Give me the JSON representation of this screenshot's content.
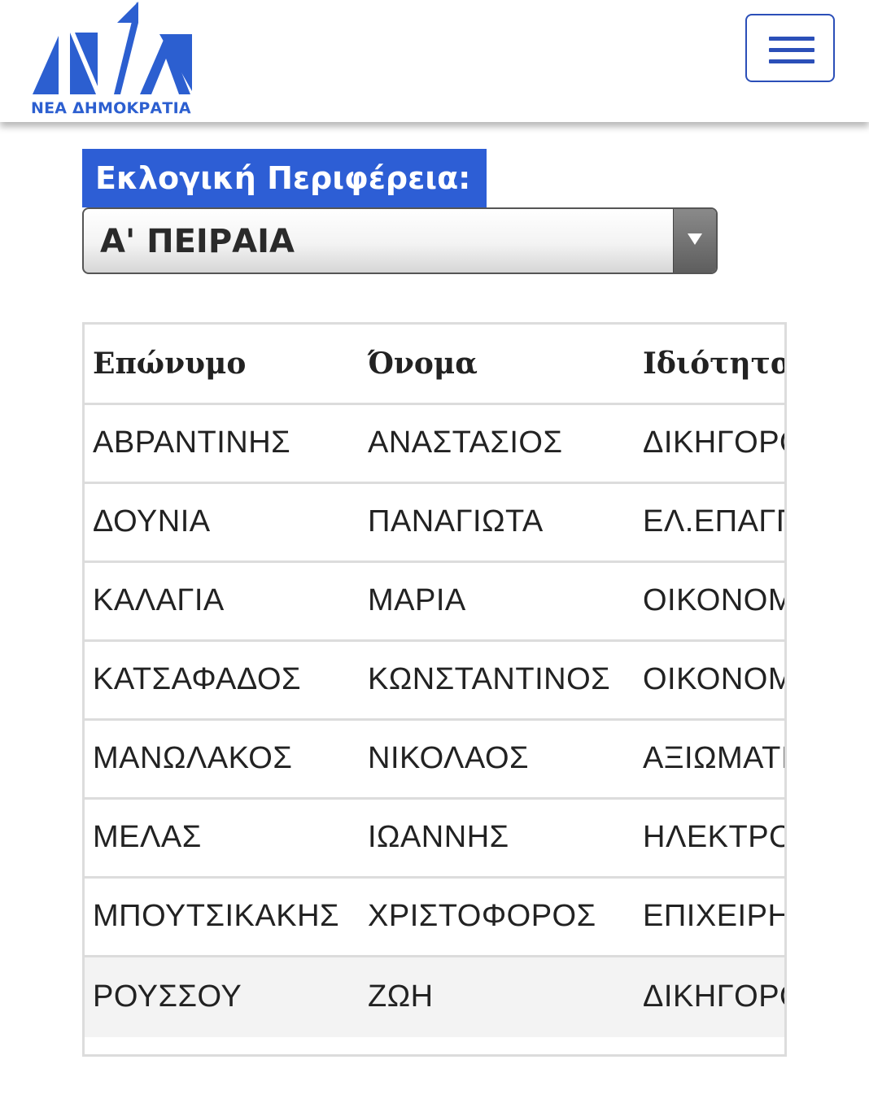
{
  "header": {
    "logo_text": "ΝΕΑ ΔΗΜΟΚΡΑΤΙΑ",
    "brand_color": "#2c5fd0",
    "menu_icon": "hamburger-menu-icon"
  },
  "region": {
    "label": "Εκλογική Περιφέρεια:",
    "selected": "Α' ΠΕΙΡΑΙΑ"
  },
  "table": {
    "headers": [
      "Επώνυμο",
      "Όνομα",
      "Ιδιότητα"
    ],
    "rows": [
      [
        "ΑΒΡΑΝΤΙΝΗΣ",
        "ΑΝΑΣΤΑΣΙΟΣ",
        "ΔΙΚΗΓΟΡΟ"
      ],
      [
        "ΔΟΥΝΙΑ",
        "ΠΑΝΑΓΙΩΤΑ",
        "ΕΛ.ΕΠΑΓΓ"
      ],
      [
        "ΚΑΛΑΓΙΑ",
        "ΜΑΡΙΑ",
        "ΟΙΚΟΝΟΜ"
      ],
      [
        "ΚΑΤΣΑΦΑΔΟΣ",
        "ΚΩΝΣΤΑΝΤΙΝΟΣ",
        "ΟΙΚΟΝΟΜ"
      ],
      [
        "ΜΑΝΩΛΑΚΟΣ",
        "ΝΙΚΟΛΑΟΣ",
        "ΑΞΙΩΜΑΤΙ"
      ],
      [
        "ΜΕΛΑΣ",
        "ΙΩΑΝΝΗΣ",
        "ΗΛΕΚΤΡΟ"
      ],
      [
        "ΜΠΟΥΤΣΙΚΑΚΗΣ",
        "ΧΡΙΣΤΟΦΟΡΟΣ",
        "ΕΠΙΧΕΙΡΗΜ"
      ],
      [
        "ΡΟΥΣΣΟΥ",
        "ΖΩΗ",
        "ΔΙΚΗΓΟΡΟ"
      ]
    ]
  }
}
